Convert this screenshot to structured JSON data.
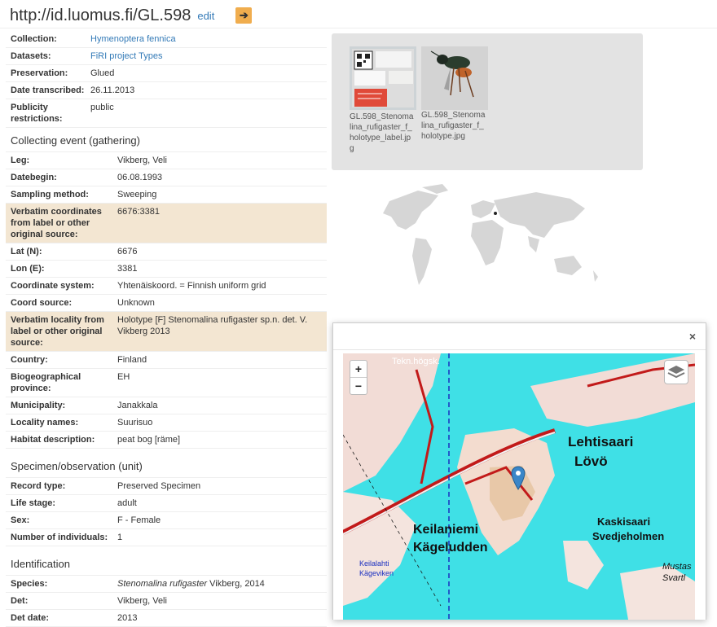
{
  "header": {
    "title": "http://id.luomus.fi/GL.598",
    "edit_label": "edit",
    "go_glyph": "➔"
  },
  "basic": [
    {
      "key": "Collection:",
      "value": "Hymenoptera fennica",
      "link": true
    },
    {
      "key": "Datasets:",
      "value": "FiRI project Types",
      "link": true
    },
    {
      "key": "Preservation:",
      "value": "Glued"
    },
    {
      "key": "Date transcribed:",
      "value": "26.11.2013"
    },
    {
      "key": "Publicity restrictions:",
      "value": "public"
    }
  ],
  "collecting": {
    "title": "Collecting event (gathering)",
    "rows": [
      {
        "key": "Leg:",
        "value": "Vikberg, Veli"
      },
      {
        "key": "Datebegin:",
        "value": "06.08.1993"
      },
      {
        "key": "Sampling method:",
        "value": "Sweeping"
      },
      {
        "key": "Verbatim coordinates from label or other original source:",
        "value": "6676:3381",
        "highlight": true
      },
      {
        "key": "Lat (N):",
        "value": "6676"
      },
      {
        "key": "Lon (E):",
        "value": "3381"
      },
      {
        "key": "Coordinate system:",
        "value": "Yhtenäiskoord. = Finnish uniform grid"
      },
      {
        "key": "Coord source:",
        "value": "Unknown"
      },
      {
        "key": "Verbatim locality from label or other original source:",
        "value": "Holotype [F] Stenomalina rufigaster sp.n. det. V. Vikberg 2013",
        "highlight": true
      },
      {
        "key": "Country:",
        "value": "Finland"
      },
      {
        "key": "Biogeographical province:",
        "value": "EH"
      },
      {
        "key": "Municipality:",
        "value": "Janakkala"
      },
      {
        "key": "Locality names:",
        "value": "Suurisuo"
      },
      {
        "key": "Habitat description:",
        "value": "peat bog [räme]"
      }
    ]
  },
  "unit": {
    "title": "Specimen/observation (unit)",
    "rows": [
      {
        "key": "Record type:",
        "value": "Preserved Specimen"
      },
      {
        "key": "Life stage:",
        "value": "adult"
      },
      {
        "key": "Sex:",
        "value": "F - Female"
      },
      {
        "key": "Number of individuals:",
        "value": "1"
      }
    ]
  },
  "identification": {
    "title": "Identification",
    "rows": [
      {
        "key": "Species:",
        "value_italic": "Stenomalina rufigaster",
        "value": " Vikberg, 2014"
      },
      {
        "key": "Det:",
        "value": "Vikberg, Veli"
      },
      {
        "key": "Det date:",
        "value": "2013"
      }
    ]
  },
  "images": [
    {
      "caption": "GL.598_Stenomalina_rufigaster_f_holotype_label.jpg"
    },
    {
      "caption": "GL.598_Stenomalina_rufigaster_f_holotype.jpg"
    }
  ],
  "popup": {
    "close_glyph": "×",
    "zoom_in": "+",
    "zoom_out": "−"
  },
  "map_labels": {
    "lehtisaari": "Lehtisaari",
    "lovo": "Lövö",
    "kaskisaari": "Kaskisaari",
    "svedje": "Svedjeholmen",
    "keilaniemi": "Keilaniemi",
    "kageludden": "Kägeludden",
    "mustas": "Mustas",
    "svartl": "Svartl",
    "teknhogsk": "Tekn.högsk.",
    "keilalahti": "Keilalahti",
    "kagewiken": "Kägeviken"
  },
  "colors": {
    "highlight": "#f3e6d2",
    "link": "#337ab7",
    "accent": "#f0ad4e",
    "water": "#3fe0e6",
    "marker": "#3a86c8"
  }
}
